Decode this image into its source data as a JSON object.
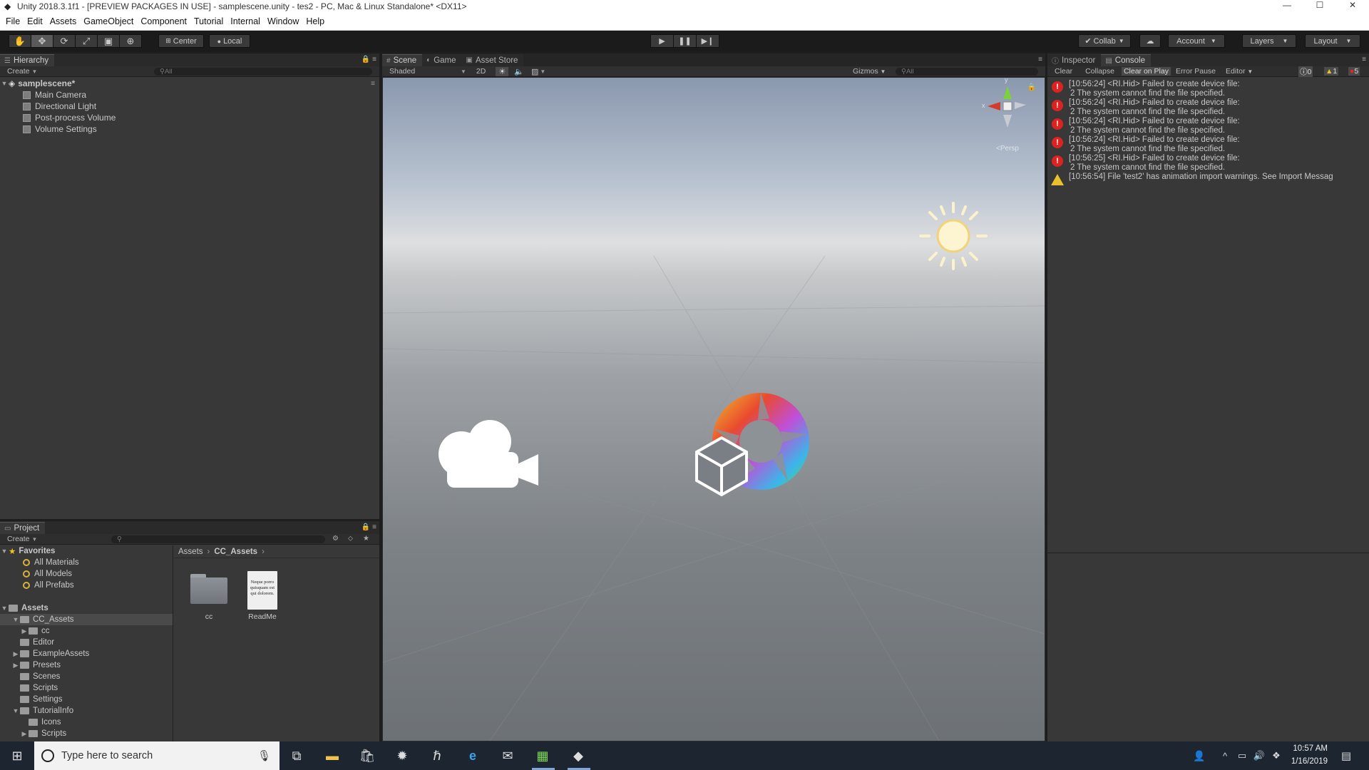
{
  "window": {
    "title": "Unity 2018.3.1f1 - [PREVIEW PACKAGES IN USE] - samplescene.unity - tes2 - PC, Mac & Linux Standalone* <DX11>",
    "minimize": "—",
    "maximize": "☐",
    "close": "✕"
  },
  "menu": [
    "File",
    "Edit",
    "Assets",
    "GameObject",
    "Component",
    "Tutorial",
    "Internal",
    "Window",
    "Help"
  ],
  "toolbar": {
    "pivot": "Center",
    "space": "Local",
    "collab": "Collab",
    "account": "Account",
    "layers": "Layers",
    "layout": "Layout"
  },
  "hierarchy": {
    "tab": "Hierarchy",
    "create": "Create",
    "search_placeholder": "All",
    "scene": "samplescene*",
    "items": [
      "Main Camera",
      "Directional Light",
      "Post-process Volume",
      "Volume Settings"
    ]
  },
  "scene": {
    "tabs": [
      "Scene",
      "Game",
      "Asset Store"
    ],
    "shading": "Shaded",
    "mode_2d": "2D",
    "gizmos": "Gizmos",
    "search_placeholder": "All",
    "persp": "Persp",
    "axis_y": "y",
    "axis_x": "x"
  },
  "project": {
    "tab": "Project",
    "create": "Create",
    "favorites": "Favorites",
    "favorite_items": [
      "All Materials",
      "All Models",
      "All Prefabs"
    ],
    "assets": "Assets",
    "tree": [
      {
        "label": "CC_Assets",
        "indent": 1,
        "arrow": "▼",
        "selected": true
      },
      {
        "label": "cc",
        "indent": 2,
        "arrow": "▶",
        "selected": false
      },
      {
        "label": "Editor",
        "indent": 1,
        "arrow": "",
        "selected": false
      },
      {
        "label": "ExampleAssets",
        "indent": 1,
        "arrow": "▶",
        "selected": false
      },
      {
        "label": "Presets",
        "indent": 1,
        "arrow": "▶",
        "selected": false
      },
      {
        "label": "Scenes",
        "indent": 1,
        "arrow": "",
        "selected": false
      },
      {
        "label": "Scripts",
        "indent": 1,
        "arrow": "",
        "selected": false
      },
      {
        "label": "Settings",
        "indent": 1,
        "arrow": "",
        "selected": false
      },
      {
        "label": "TutorialInfo",
        "indent": 1,
        "arrow": "▼",
        "selected": false
      },
      {
        "label": "Icons",
        "indent": 2,
        "arrow": "",
        "selected": false
      },
      {
        "label": "Scripts",
        "indent": 2,
        "arrow": "▶",
        "selected": false
      }
    ],
    "breadcrumb": [
      "Assets",
      "CC_Assets"
    ],
    "files": [
      {
        "label": "cc",
        "kind": "folder"
      },
      {
        "label": "ReadMe",
        "kind": "doc",
        "preview": "Neque porro quisquam est qui dolorem."
      }
    ]
  },
  "console": {
    "tabs": [
      "Inspector",
      "Console"
    ],
    "buttons": [
      "Clear",
      "Collapse",
      "Clear on Play",
      "Error Pause",
      "Editor"
    ],
    "counts": {
      "log": "0",
      "warn": "1",
      "error": "5"
    },
    "entries": [
      {
        "type": "error",
        "line1": "[10:56:24] <RI.Hid> Failed to create device file:",
        "line2": "2 The system cannot find the file specified."
      },
      {
        "type": "error",
        "line1": "[10:56:24] <RI.Hid> Failed to create device file:",
        "line2": "2 The system cannot find the file specified."
      },
      {
        "type": "error",
        "line1": "[10:56:24] <RI.Hid> Failed to create device file:",
        "line2": "2 The system cannot find the file specified."
      },
      {
        "type": "error",
        "line1": "[10:56:24] <RI.Hid> Failed to create device file:",
        "line2": "2 The system cannot find the file specified."
      },
      {
        "type": "error",
        "line1": "[10:56:25] <RI.Hid> Failed to create device file:",
        "line2": "2 The system cannot find the file specified."
      },
      {
        "type": "warning",
        "line1": "[10:56:54] File 'test2' has animation import warnings. See Import Messag",
        "line2": ""
      }
    ]
  },
  "taskbar": {
    "search_placeholder": "Type here to search",
    "time": "10:57 AM",
    "date": "1/16/2019"
  }
}
